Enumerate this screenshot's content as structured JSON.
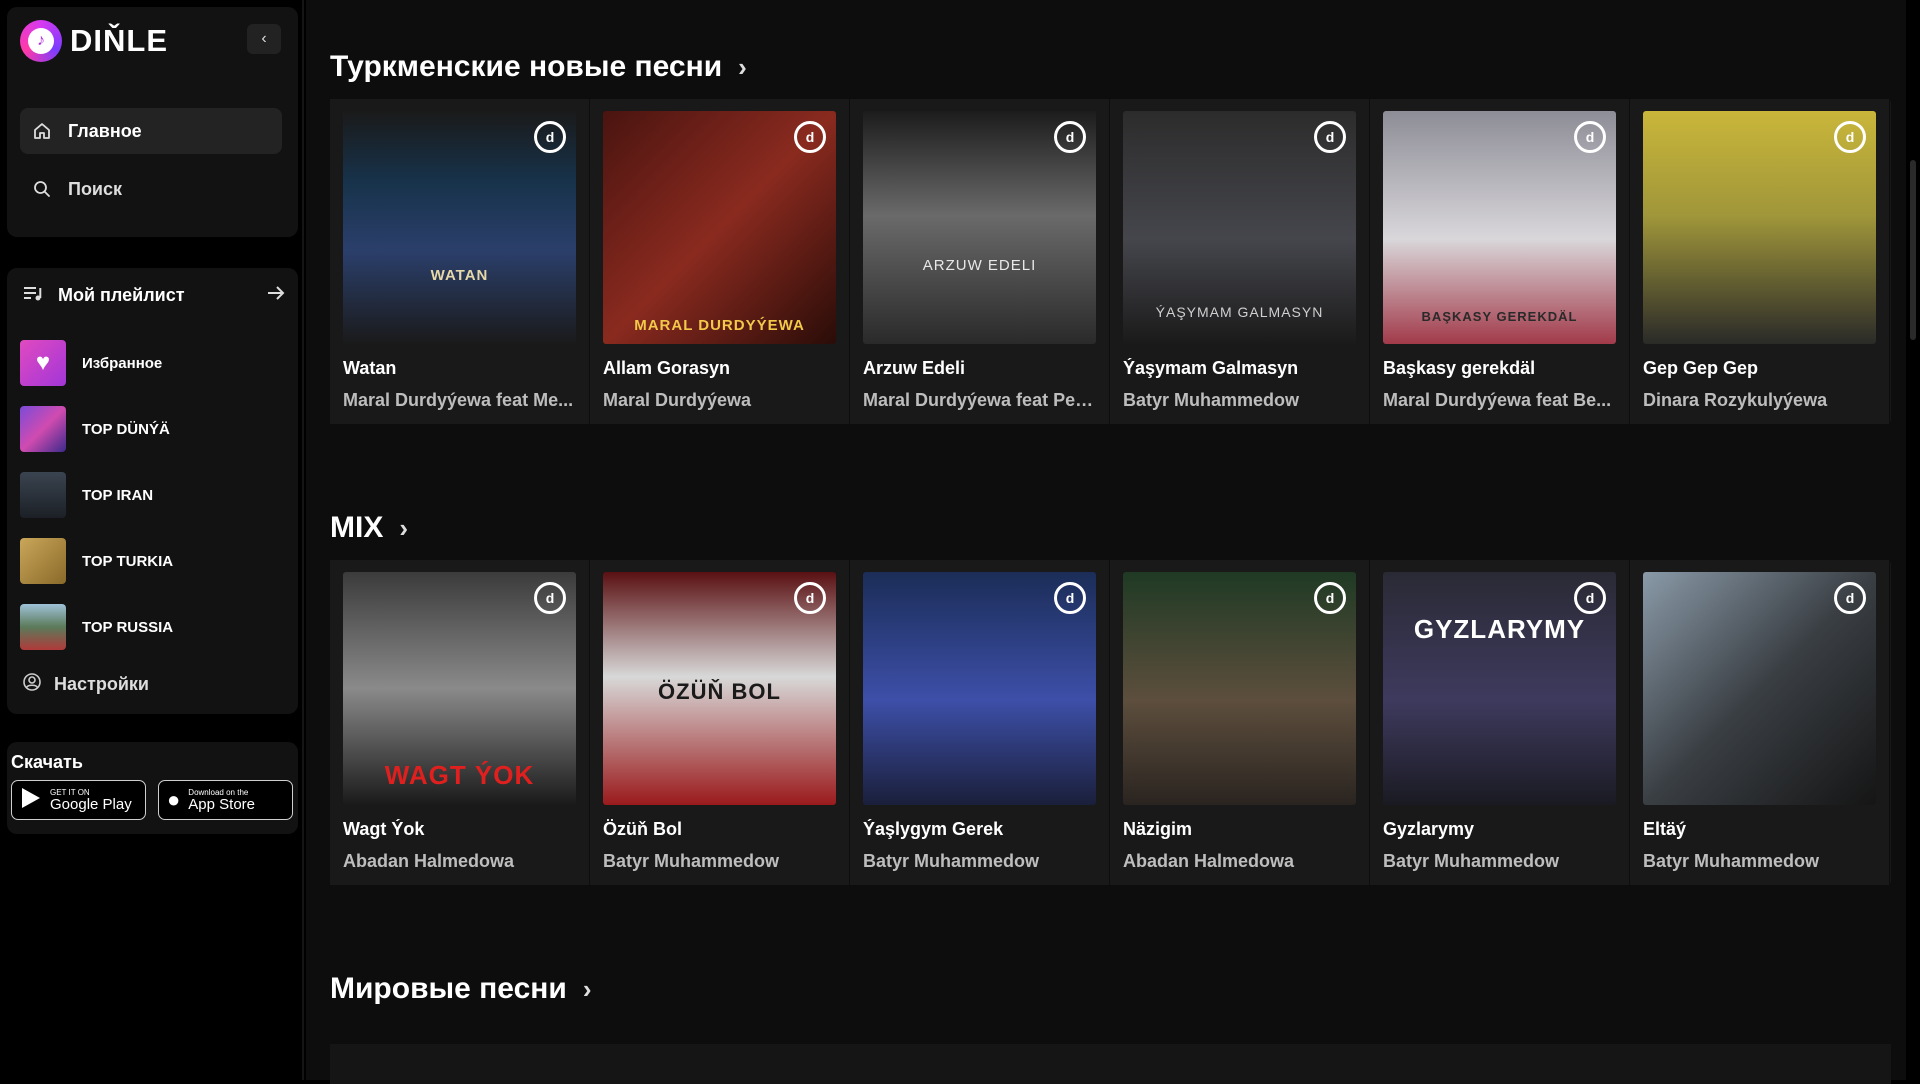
{
  "app": {
    "logo_text": "DIŇLE",
    "collapse_icon": "‹"
  },
  "nav": {
    "items": [
      {
        "label": "Главное",
        "icon": "home-icon"
      },
      {
        "label": "Поиск",
        "icon": "search-icon"
      }
    ]
  },
  "playlist": {
    "title": "Мой плейлист",
    "items": [
      {
        "label": "Избранное",
        "color": "#c33fd6"
      },
      {
        "label": "TOP DÜNÝÄ",
        "color": "#6a3fb5"
      },
      {
        "label": "TOP IRAN",
        "color": "#3b4048"
      },
      {
        "label": "TOP TURKIA",
        "color": "#a07e3a"
      },
      {
        "label": "TOP RUSSIA",
        "color": "#5d7f95"
      }
    ],
    "settings_label": "Настройки"
  },
  "download": {
    "title": "Скачать",
    "google": {
      "small": "GET IT ON",
      "big": "Google Play"
    },
    "apple": {
      "small": "Download on the",
      "big": "App Store"
    }
  },
  "sections": [
    {
      "title": "Туркменские новые песни",
      "cards": [
        {
          "title": "Watan",
          "artist": "Maral Durdyýewa feat Me...",
          "cover_text": "WATAN",
          "bg": "linear-gradient(180deg,#1a1a1a 0%,#17324a 30%,#2b3f6b 60%,#1a1a1a 100%)"
        },
        {
          "title": "Allam Gorasyn",
          "artist": "Maral Durdyýewa",
          "cover_text": "MARAL DURDYÝEWA",
          "bg": "linear-gradient(135deg,#4a1410 0%,#8a2a1f 50%,#2a0c08 100%)"
        },
        {
          "title": "Arzuw Edeli",
          "artist": "Maral Durdyýewa feat Per...",
          "cover_text": "ARZUW EDELI",
          "bg": "linear-gradient(180deg,#1c1c1c 0%,#6a6a6a 45%,#2a2a2a 100%)"
        },
        {
          "title": "Ýaşymam Galmasyn",
          "artist": "Batyr Muhammedow",
          "cover_text": "ÝAŞYMAM GALMASYN",
          "bg": "linear-gradient(180deg,#2c2c2c 0%,#45464c 55%,#1a1a1a 100%)"
        },
        {
          "title": "Başkasy gerekdäl",
          "artist": "Maral Durdyýewa feat Be...",
          "cover_text": "BAŞKASY GEREKDÄL",
          "bg": "linear-gradient(180deg,#8d8d97 0%,#d9d7da 55%,#a23a4a 100%)"
        },
        {
          "title": "Gep Gep Gep",
          "artist": "Dinara Rozykulyýewa",
          "cover_text": "",
          "bg": "linear-gradient(180deg,#c9b63a 0%,#a0963a 45%,#2a2a28 100%)"
        }
      ]
    },
    {
      "title": "MIX",
      "cards": [
        {
          "title": "Wagt Ýok",
          "artist": "Abadan Halmedowa",
          "cover_text": "WAGT ÝOK",
          "bg": "linear-gradient(180deg,#3b3b3b 0%,#8a8a8a 50%,#1a1a1a 100%)"
        },
        {
          "title": "Özüň Bol",
          "artist": "Batyr Muhammedow",
          "cover_text": "ÖZÜŇ BOL",
          "bg": "linear-gradient(180deg,#5a1012 0%,#d8d8d8 45%,#9a1a1c 100%)"
        },
        {
          "title": "Ýaşlygym Gerek",
          "artist": "Batyr Muhammedow",
          "cover_text": "",
          "bg": "linear-gradient(180deg,#1b2d57 0%,#3d4fa8 55%,#1a1f3a 100%)"
        },
        {
          "title": "Näzigim",
          "artist": "Abadan Halmedowa",
          "cover_text": "",
          "bg": "linear-gradient(180deg,#1f3a24 0%,#5d4e3d 55%,#2a2420 100%)"
        },
        {
          "title": "Gyzlarymy",
          "artist": "Batyr Muhammedow",
          "cover_text": "GYZLARYMY",
          "bg": "linear-gradient(180deg,#2a2a35 0%,#3e3a5e 55%,#1a1a22 100%)"
        },
        {
          "title": "Eltäý",
          "artist": "Batyr Muhammedow",
          "cover_text": "",
          "bg": "linear-gradient(135deg,#8a9aa8 0%,#3a3f44 50%,#151515 100%)"
        }
      ]
    },
    {
      "title": "Мировые песни",
      "cards": []
    }
  ]
}
